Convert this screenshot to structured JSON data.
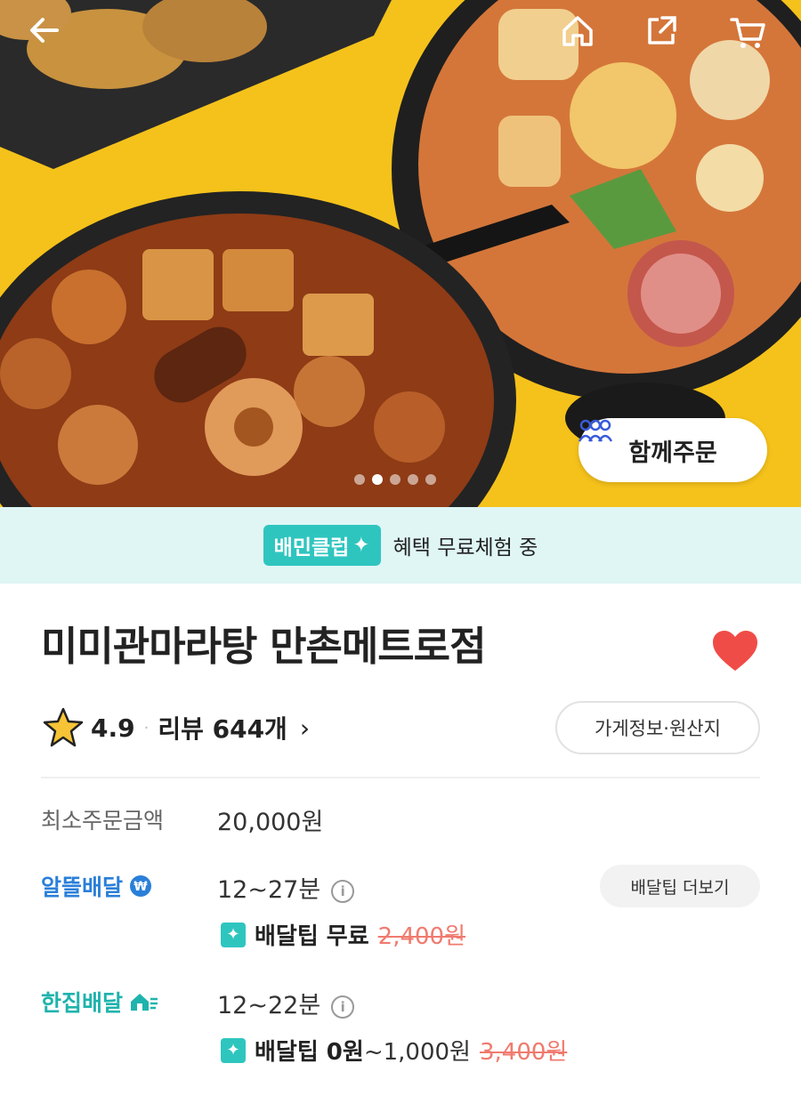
{
  "header": {
    "back_icon": "back-arrow-icon",
    "home_icon": "home-icon",
    "share_icon": "share-icon",
    "cart_icon": "cart-icon"
  },
  "hero": {
    "together_order_label": "함께주문",
    "carousel_total": 5,
    "carousel_active": 1
  },
  "club_banner": {
    "badge": "배민클럽",
    "text": "혜택 무료체험 중"
  },
  "store": {
    "name": "미미관마라탕 만촌메트로점",
    "rating": "4.9",
    "separator": "·",
    "review_label": "리뷰 644개",
    "chevron": "›",
    "info_button": "가게정보·원산지"
  },
  "order_info": {
    "min_order_label": "최소주문금액",
    "min_order_value": "20,000원"
  },
  "delivery_saver": {
    "label": "알뜰배달",
    "time": "12~27분",
    "tip_more": "배달팁 더보기",
    "tip_label": "배달팁 무료",
    "tip_original": "2,400원"
  },
  "delivery_single": {
    "label": "한집배달",
    "time": "12~22분",
    "tip_label": "배달팁 0원",
    "tip_range": "~1,000원",
    "tip_original": "3,400원"
  },
  "colors": {
    "hero_bg": "#f5c21b",
    "club_bg": "#dff6f5",
    "club_accent": "#2fc5bf",
    "blue": "#2a7fd9",
    "heart": "#f04c47",
    "strike": "#f07a6e"
  }
}
